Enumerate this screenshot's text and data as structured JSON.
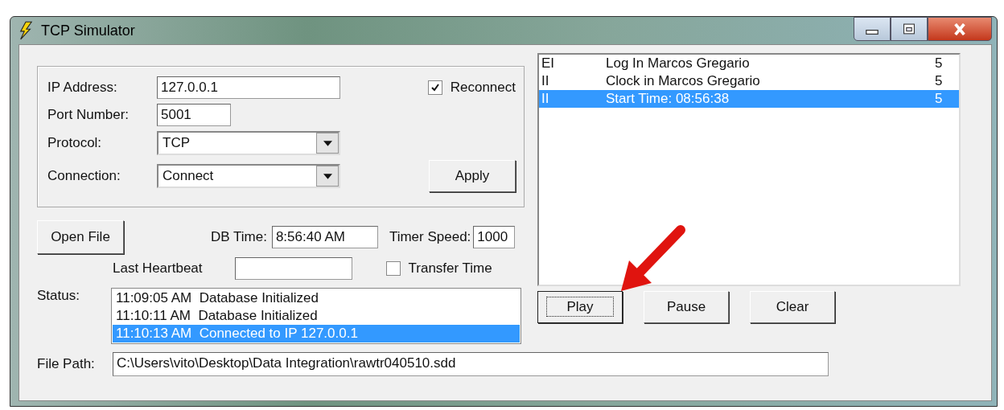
{
  "window": {
    "title": "TCP Simulator"
  },
  "connection": {
    "ip_label": "IP Address:",
    "ip_value": "127.0.0.1",
    "port_label": "Port Number:",
    "port_value": "5001",
    "protocol_label": "Protocol:",
    "protocol_value": "TCP",
    "connection_label": "Connection:",
    "connection_value": "Connect",
    "reconnect": {
      "label": "Reconnect",
      "checked": true
    },
    "apply_button": "Apply"
  },
  "open_file_button": "Open File",
  "db_time": {
    "label": "DB Time:",
    "value": "8:56:40 AM"
  },
  "timer_speed": {
    "label": "Timer Speed:",
    "value": "1000"
  },
  "transfer_time": {
    "label": "Transfer Time",
    "checked": false
  },
  "last_heartbeat": {
    "label": "Last Heartbeat"
  },
  "event_list": [
    {
      "code": "EI",
      "text": "Log In Marcos Gregario",
      "count": "5",
      "selected": false
    },
    {
      "code": "II",
      "text": "Clock in Marcos Gregario",
      "count": "5",
      "selected": false
    },
    {
      "code": "II",
      "text": "Start Time: 08:56:38",
      "count": "5",
      "selected": true
    }
  ],
  "playback_buttons": [
    {
      "label": "Play",
      "focused": true
    },
    {
      "label": "Pause",
      "focused": false
    },
    {
      "label": "Clear",
      "focused": false
    }
  ],
  "status": {
    "label": "Status:",
    "lines": [
      {
        "time": "11:09:05 AM",
        "message": "Database Initialized",
        "selected": false
      },
      {
        "time": "11:10:11 AM",
        "message": "Database Initialized",
        "selected": false
      },
      {
        "time": "11:10:13 AM",
        "message": "Connected to IP 127.0.0.1",
        "selected": true
      }
    ]
  },
  "file_path": {
    "label": "File Path:",
    "value": "C:\\Users\\vito\\Desktop\\Data Integration\\rawtr040510.sdd"
  }
}
